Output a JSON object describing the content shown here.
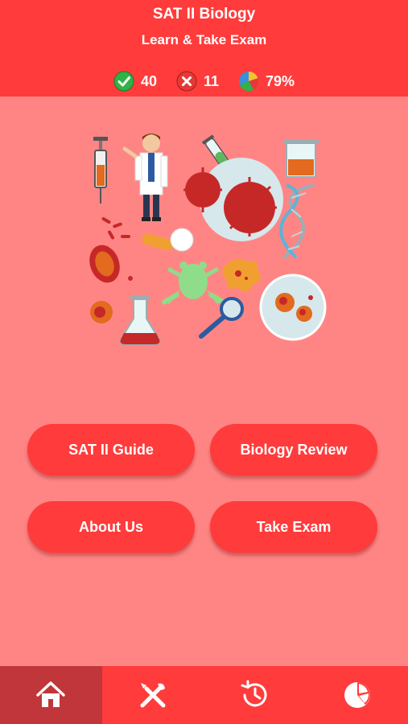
{
  "header": {
    "title": "SAT II Biology",
    "subtitle": "Learn & Take Exam"
  },
  "stats": {
    "correct": {
      "icon": "check-circle-icon",
      "value": "40",
      "color": "#2fb344"
    },
    "wrong": {
      "icon": "x-circle-icon",
      "value": "11",
      "color": "#e53935"
    },
    "score": {
      "icon": "pie-chart-icon",
      "value": "79%"
    }
  },
  "illustration": {
    "icons": [
      "syringe-icon",
      "scientist-icon",
      "virus-icon",
      "test-tube-icon",
      "beaker-icon",
      "dna-icon",
      "bacteria-icon",
      "cell-icon",
      "pill-icon",
      "frog-icon",
      "amoeba-icon",
      "flask-icon",
      "magnifier-icon",
      "petri-dish-icon"
    ]
  },
  "menu": {
    "buttons": [
      "SAT II Guide",
      "Biology Review",
      "About Us",
      "Take Exam"
    ]
  },
  "tabbar": {
    "tabs": [
      {
        "icon": "home-icon",
        "active": true
      },
      {
        "icon": "tools-icon",
        "active": false
      },
      {
        "icon": "history-icon",
        "active": false
      },
      {
        "icon": "stats-pie-icon",
        "active": false
      }
    ]
  },
  "colors": {
    "primary": "#ff3b3b",
    "background": "#ff8585",
    "active_tab": "#c0363a"
  }
}
